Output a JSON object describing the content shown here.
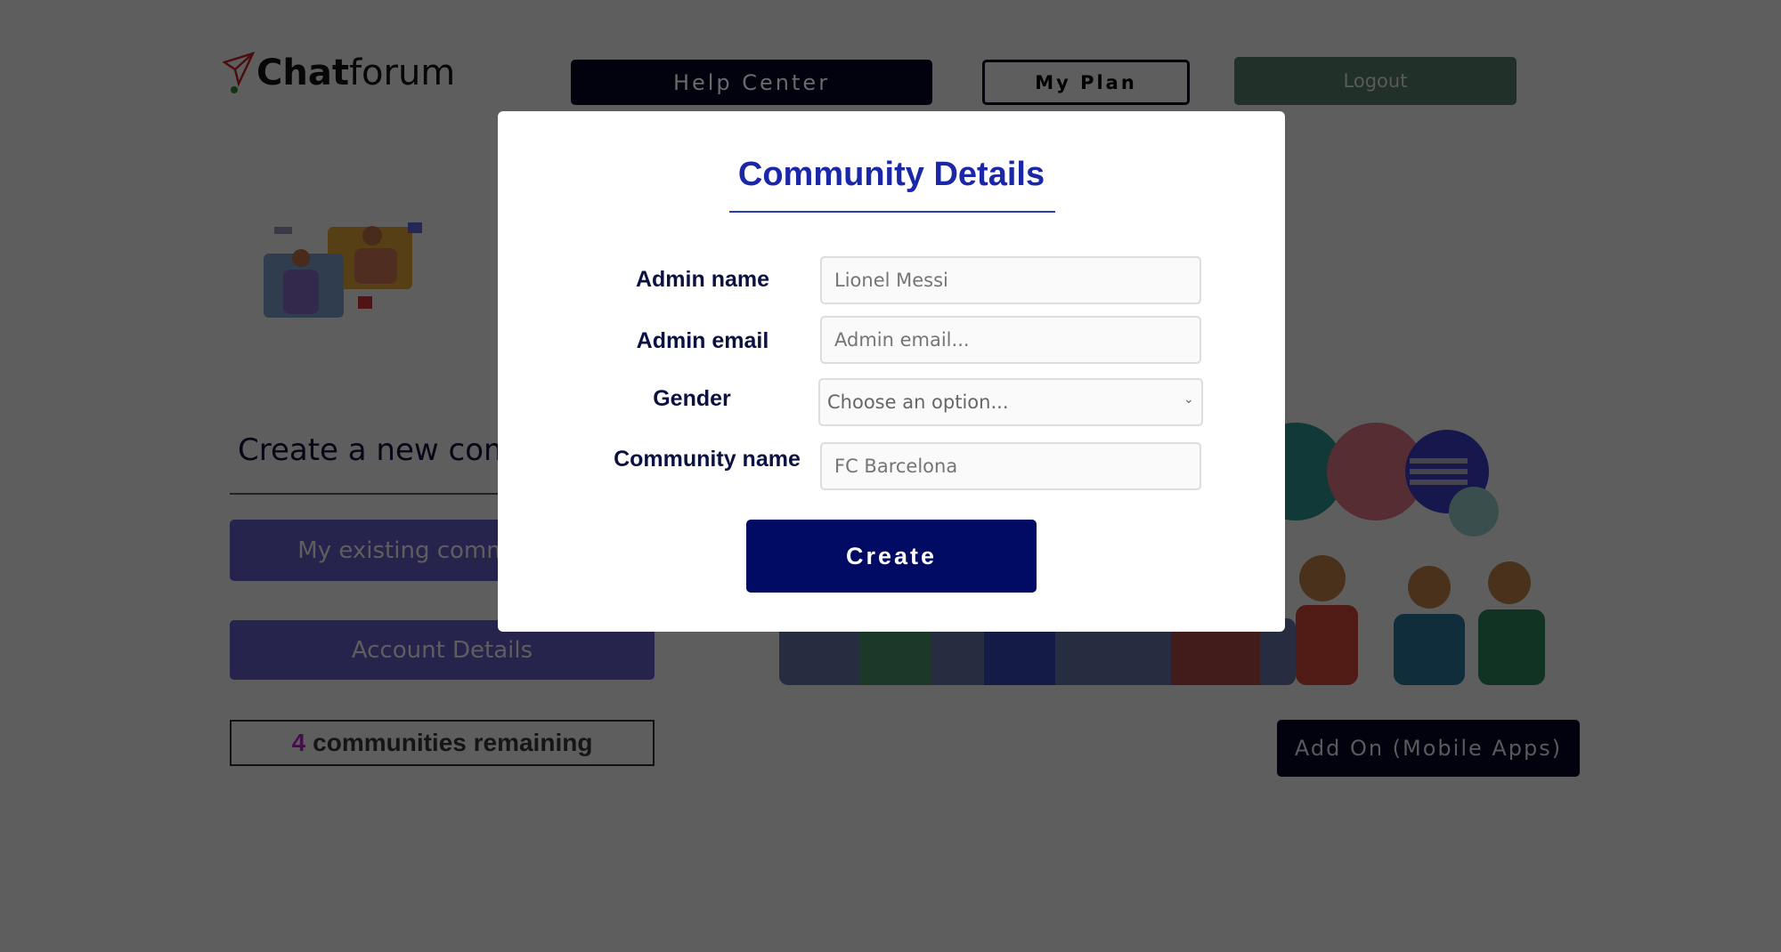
{
  "header": {
    "logo_bold": "Chat",
    "logo_light": "forum",
    "help_center": "Help Center",
    "my_plan": "My Plan",
    "logout": "Logout"
  },
  "main": {
    "create_title": "Create a new community",
    "existing_button": "My existing communities",
    "account_button": "Account Details",
    "remaining_count": "4",
    "remaining_text": "communities remaining",
    "addon_button": "Add On (Mobile Apps)"
  },
  "modal": {
    "title": "Community Details",
    "fields": [
      {
        "label": "Admin name",
        "placeholder": "Lionel Messi"
      },
      {
        "label": "Admin email",
        "placeholder": "Admin email..."
      },
      {
        "label": "Gender",
        "selected": "Choose an option..."
      },
      {
        "label": "Community name",
        "placeholder": "FC Barcelona"
      }
    ],
    "create_button": "Create"
  },
  "colors": {
    "accent": "#1a27a8",
    "primary_button": "#020b63",
    "logout": "#36584d",
    "purple_button": "#5a55c9"
  },
  "icons": {
    "logo": "paper-plane-icon",
    "select": "chevron-down-icon"
  }
}
